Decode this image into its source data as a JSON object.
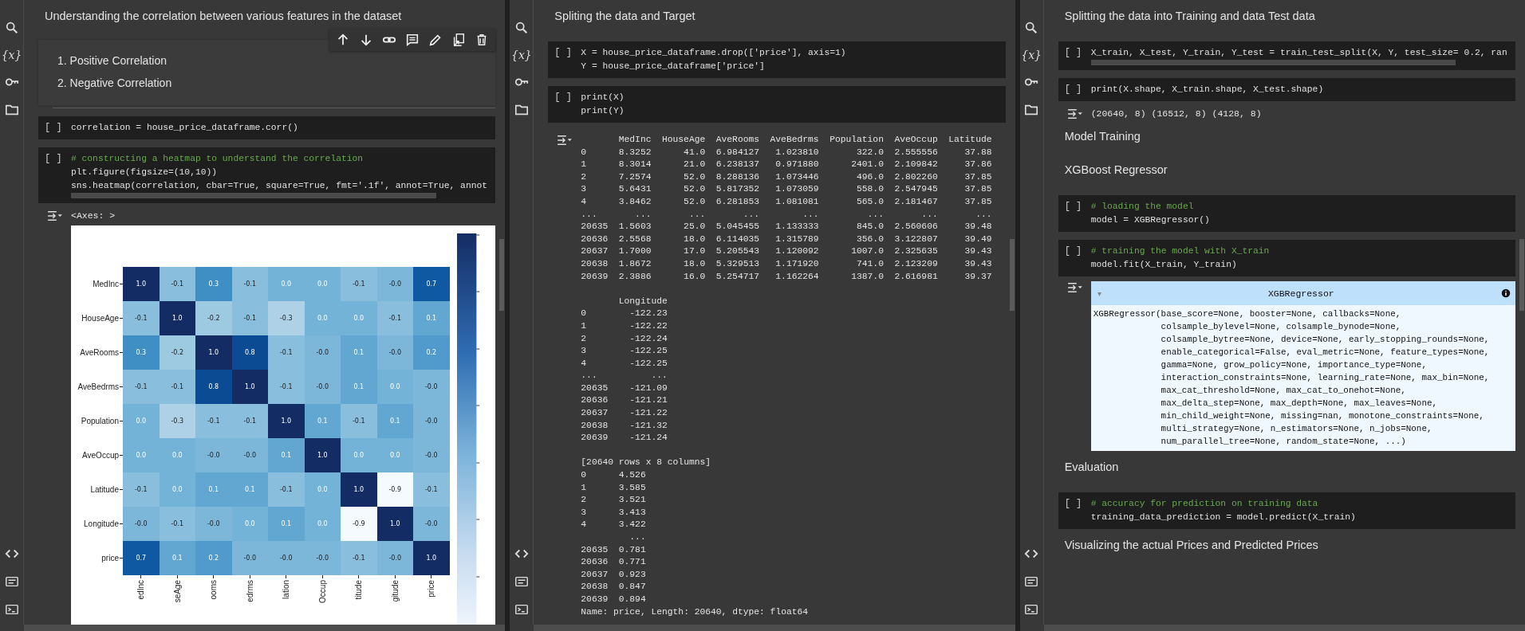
{
  "panes": [
    {
      "rail_label": "{x}",
      "cells": [
        {
          "kind": "heading",
          "text": "Understanding the correlation between various features in the dataset"
        },
        {
          "kind": "list",
          "toolbar": true,
          "items": [
            "1. Positive Correlation",
            "2. Negative Correlation"
          ]
        },
        {
          "kind": "code",
          "prompt": "[ ]",
          "hscroll": false,
          "lines": [
            {
              "kind": "code",
              "text": "correlation = house_price_dataframe.corr()"
            }
          ]
        },
        {
          "kind": "code",
          "prompt": "[ ]",
          "hscroll": true,
          "lines": [
            {
              "kind": "comment",
              "text": "# constructing a heatmap to understand the correlation"
            },
            {
              "kind": "code",
              "text": "plt.figure(figsize=(10,10))"
            },
            {
              "kind": "code",
              "text": "sns.heatmap(correlation, cbar=True, square=True, fmt='.1f', annot=True, annot"
            }
          ]
        },
        {
          "kind": "output",
          "text": "<Axes: >"
        },
        {
          "kind": "heatmap",
          "x_axis_labels": [
            "edInc",
            "seAge",
            "ooms",
            "edrms",
            "lation",
            "Occup",
            "titude",
            "gitude",
            "price"
          ],
          "rows": [
            {
              "label": "MedInc",
              "cells": [
                "1.0",
                "-0.1",
                "0.3",
                "-0.1",
                "0.0",
                "0.0",
                "-0.1",
                "-0.0",
                "0.7"
              ]
            },
            {
              "label": "HouseAge",
              "cells": [
                "-0.1",
                "1.0",
                "-0.2",
                "-0.1",
                "-0.3",
                "0.0",
                "0.0",
                "-0.1",
                "0.1"
              ]
            },
            {
              "label": "AveRooms",
              "cells": [
                "0.3",
                "-0.2",
                "1.0",
                "0.8",
                "-0.1",
                "-0.0",
                "0.1",
                "-0.0",
                "0.2"
              ]
            },
            {
              "label": "AveBedrms",
              "cells": [
                "-0.1",
                "-0.1",
                "0.8",
                "1.0",
                "-0.1",
                "-0.0",
                "0.1",
                "0.0",
                "-0.0"
              ]
            },
            {
              "label": "Population",
              "cells": [
                "0.0",
                "-0.3",
                "-0.1",
                "-0.1",
                "1.0",
                "0.1",
                "-0.1",
                "0.1",
                "-0.0"
              ]
            },
            {
              "label": "AveOccup",
              "cells": [
                "0.0",
                "0.0",
                "-0.0",
                "-0.0",
                "0.1",
                "1.0",
                "0.0",
                "0.0",
                "-0.0"
              ]
            },
            {
              "label": "Latitude",
              "cells": [
                "-0.1",
                "0.0",
                "0.1",
                "0.1",
                "-0.1",
                "0.0",
                "1.0",
                "-0.9",
                "-0.1"
              ]
            },
            {
              "label": "Longitude",
              "cells": [
                "-0.0",
                "-0.1",
                "-0.0",
                "0.0",
                "0.1",
                "0.0",
                "-0.9",
                "1.0",
                "-0.0"
              ]
            },
            {
              "label": "price",
              "cells": [
                "0.7",
                "0.1",
                "0.2",
                "-0.0",
                "-0.0",
                "-0.0",
                "-0.1",
                "-0.0",
                "1.0"
              ]
            }
          ]
        }
      ]
    },
    {
      "rail_label": "{x}",
      "cells": [
        {
          "kind": "heading",
          "text": "Spliting the data and Target"
        },
        {
          "kind": "code",
          "prompt": "[ ]",
          "hscroll": false,
          "lines": [
            {
              "kind": "code",
              "text": "X = house_price_dataframe.drop(['price'], axis=1)"
            },
            {
              "kind": "code",
              "text": "Y = house_price_dataframe['price']"
            }
          ]
        },
        {
          "kind": "code",
          "prompt": "[ ]",
          "hscroll": false,
          "lines": [
            {
              "kind": "code",
              "text": "print(X)"
            },
            {
              "kind": "code",
              "text": "print(Y)"
            }
          ]
        },
        {
          "kind": "print",
          "blocks": [
            {
              "kind": "table",
              "columns": [
                "MedInc",
                "HouseAge",
                "AveRooms",
                "AveBedrms",
                "Population",
                "AveOccup",
                "Latitude"
              ],
              "rows": [
                {
                  "index": "0",
                  "cells": [
                    "8.3252",
                    "41.0",
                    "6.984127",
                    "1.023810",
                    "322.0",
                    "2.555556",
                    "37.88"
                  ]
                },
                {
                  "index": "1",
                  "cells": [
                    "8.3014",
                    "21.0",
                    "6.238137",
                    "0.971880",
                    "2401.0",
                    "2.109842",
                    "37.86"
                  ]
                },
                {
                  "index": "2",
                  "cells": [
                    "7.2574",
                    "52.0",
                    "8.288136",
                    "1.073446",
                    "496.0",
                    "2.802260",
                    "37.85"
                  ]
                },
                {
                  "index": "3",
                  "cells": [
                    "5.6431",
                    "52.0",
                    "5.817352",
                    "1.073059",
                    "558.0",
                    "2.547945",
                    "37.85"
                  ]
                },
                {
                  "index": "4",
                  "cells": [
                    "3.8462",
                    "52.0",
                    "6.281853",
                    "1.081081",
                    "565.0",
                    "2.181467",
                    "37.85"
                  ]
                },
                {
                  "index": "...",
                  "cells": [
                    "...",
                    "...",
                    "...",
                    "...",
                    "...",
                    "...",
                    "..."
                  ]
                },
                {
                  "index": "20635",
                  "cells": [
                    "1.5603",
                    "25.0",
                    "5.045455",
                    "1.133333",
                    "845.0",
                    "2.560606",
                    "39.48"
                  ]
                },
                {
                  "index": "20636",
                  "cells": [
                    "2.5568",
                    "18.0",
                    "6.114035",
                    "1.315789",
                    "356.0",
                    "3.122807",
                    "39.49"
                  ]
                },
                {
                  "index": "20637",
                  "cells": [
                    "1.7000",
                    "17.0",
                    "5.205543",
                    "1.120092",
                    "1007.0",
                    "2.325635",
                    "39.43"
                  ]
                },
                {
                  "index": "20638",
                  "cells": [
                    "1.8672",
                    "18.0",
                    "5.329513",
                    "1.171920",
                    "741.0",
                    "2.123209",
                    "39.43"
                  ]
                },
                {
                  "index": "20639",
                  "cells": [
                    "2.3886",
                    "16.0",
                    "5.254717",
                    "1.162264",
                    "1387.0",
                    "2.616981",
                    "39.37"
                  ]
                }
              ]
            },
            {
              "kind": "table",
              "columns": [
                "Longitude"
              ],
              "rows": [
                {
                  "index": "0",
                  "cells": [
                    "-122.23"
                  ]
                },
                {
                  "index": "1",
                  "cells": [
                    "-122.22"
                  ]
                },
                {
                  "index": "2",
                  "cells": [
                    "-122.24"
                  ]
                },
                {
                  "index": "3",
                  "cells": [
                    "-122.25"
                  ]
                },
                {
                  "index": "4",
                  "cells": [
                    "-122.25"
                  ]
                },
                {
                  "index": "...",
                  "cells": [
                    "..."
                  ]
                },
                {
                  "index": "20635",
                  "cells": [
                    "-121.09"
                  ]
                },
                {
                  "index": "20636",
                  "cells": [
                    "-121.21"
                  ]
                },
                {
                  "index": "20637",
                  "cells": [
                    "-121.22"
                  ]
                },
                {
                  "index": "20638",
                  "cells": [
                    "-121.32"
                  ]
                },
                {
                  "index": "20639",
                  "cells": [
                    "-121.24"
                  ]
                }
              ]
            },
            {
              "kind": "dims",
              "text": "[20640 rows x 8 columns]"
            },
            {
              "kind": "series",
              "rows": [
                {
                  "index": "0",
                  "cells": [
                    "4.526"
                  ]
                },
                {
                  "index": "1",
                  "cells": [
                    "3.585"
                  ]
                },
                {
                  "index": "2",
                  "cells": [
                    "3.521"
                  ]
                },
                {
                  "index": "3",
                  "cells": [
                    "3.413"
                  ]
                },
                {
                  "index": "4",
                  "cells": [
                    "3.422"
                  ]
                },
                {
                  "cells": [
                    "..."
                  ]
                },
                {
                  "index": "20635",
                  "cells": [
                    "0.781"
                  ]
                },
                {
                  "index": "20636",
                  "cells": [
                    "0.771"
                  ]
                },
                {
                  "index": "20637",
                  "cells": [
                    "0.923"
                  ]
                },
                {
                  "index": "20638",
                  "cells": [
                    "0.847"
                  ]
                },
                {
                  "index": "20639",
                  "cells": [
                    "0.894"
                  ]
                }
              ]
            },
            {
              "kind": "info",
              "text": "Name: price, Length: 20640, dtype: float64"
            }
          ]
        }
      ]
    },
    {
      "rail_label": "{x}",
      "cells": [
        {
          "kind": "heading",
          "text": "Splitting the data into Training and data Test data"
        },
        {
          "kind": "code",
          "prompt": "[ ]",
          "hscroll": true,
          "lines": [
            {
              "kind": "code",
              "text": "X_train, X_test, Y_train, Y_test = train_test_split(X, Y, test_size= 0.2, ran"
            }
          ]
        },
        {
          "kind": "code",
          "prompt": "[ ]",
          "hscroll": false,
          "lines": [
            {
              "kind": "code",
              "text": "print(X.shape, X_train.shape, X_test.shape)"
            }
          ]
        },
        {
          "kind": "output",
          "text": "(20640, 8) (16512, 8) (4128, 8)"
        },
        {
          "kind": "heading",
          "text": "Model Training"
        },
        {
          "kind": "heading",
          "text": "XGBoost Regressor"
        },
        {
          "kind": "code",
          "prompt": "[ ]",
          "hscroll": false,
          "lines": [
            {
              "kind": "comment",
              "text": "# loading the model"
            },
            {
              "kind": "code",
              "text": "model = XGBRegressor()"
            }
          ]
        },
        {
          "kind": "code",
          "prompt": "[ ]",
          "hscroll": false,
          "lines": [
            {
              "kind": "comment",
              "text": "# training the model with X_train"
            },
            {
              "kind": "code",
              "text": "model.fit(X_train, Y_train)"
            }
          ]
        },
        {
          "kind": "widget",
          "toggle": "▾",
          "title": "XGBRegressor",
          "lines": [
            "XGBRegressor(base_score=None, booster=None, callbacks=None,",
            "             colsample_bylevel=None, colsample_bynode=None,",
            "             colsample_bytree=None, device=None, early_stopping_rounds=None,",
            "             enable_categorical=False, eval_metric=None, feature_types=None,",
            "             gamma=None, grow_policy=None, importance_type=None,",
            "             interaction_constraints=None, learning_rate=None, max_bin=None,",
            "             max_cat_threshold=None, max_cat_to_onehot=None,",
            "             max_delta_step=None, max_depth=None, max_leaves=None,",
            "             min_child_weight=None, missing=nan, monotone_constraints=None,",
            "             multi_strategy=None, n_estimators=None, n_jobs=None,",
            "             num_parallel_tree=None, random_state=None, ...)"
          ]
        },
        {
          "kind": "heading",
          "text": "Evaluation"
        },
        {
          "kind": "code",
          "prompt": "[ ]",
          "hscroll": false,
          "lines": [
            {
              "kind": "comment",
              "text": "# accuracy for prediction on training data"
            },
            {
              "kind": "code",
              "text": "training_data_prediction = model.predict(X_train)"
            }
          ]
        },
        {
          "kind": "heading",
          "text": "Visualizing the actual Prices and Predicted Prices"
        }
      ]
    }
  ]
}
